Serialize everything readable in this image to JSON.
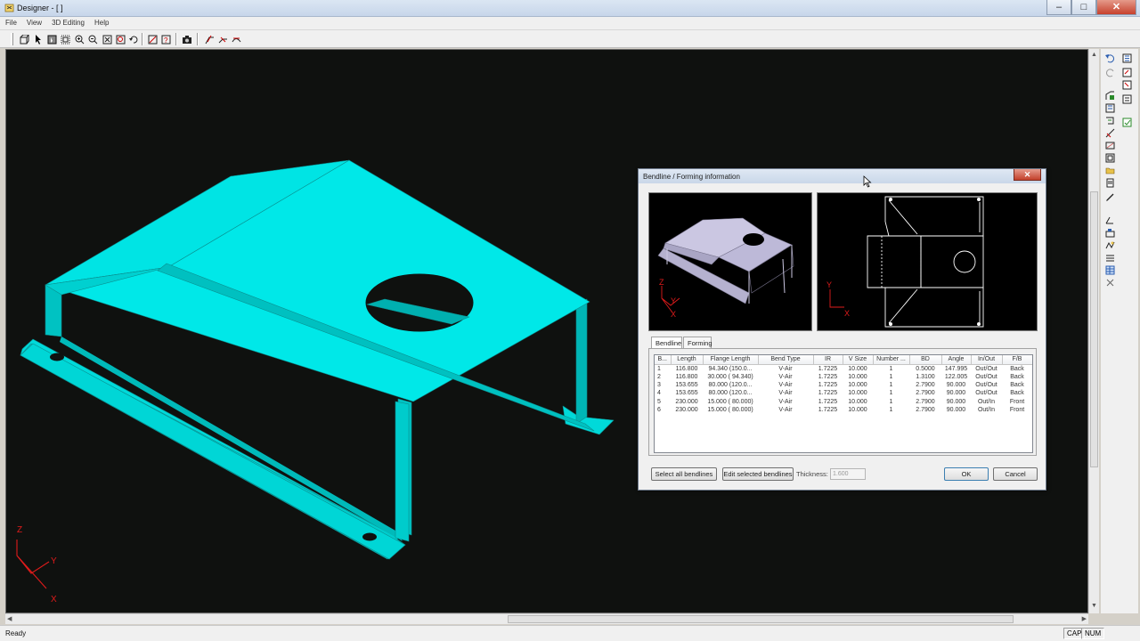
{
  "window": {
    "title": "Designer - [ ]",
    "min_glyph": "–",
    "max_glyph": "□",
    "close_glyph": "✕"
  },
  "menu": [
    "File",
    "View",
    "3D Editing",
    "Help"
  ],
  "toolbar_icons": [
    "box-view-icon",
    "pointer-icon",
    "select-icon",
    "grid-icon",
    "zoom-in-icon",
    "zoom-out-icon",
    "zoom-fit-icon",
    "zoom-window-icon",
    "rotate-icon",
    "measure-icon",
    "query-icon",
    "camera-icon",
    "bend-icon",
    "unfold-icon",
    "form-icon"
  ],
  "colors": {
    "part": "#00e6e6",
    "background": "#0f110f",
    "preview_part": "#b7b3d2",
    "axis": "#e01b1b"
  },
  "axes_labels": {
    "z": "Z",
    "y": "Y",
    "x": "X"
  },
  "dialog": {
    "title": "Bendline / Forming information",
    "close_glyph": "✕",
    "tabs": [
      "Bendline",
      "Forming"
    ],
    "columns": [
      "B...",
      "Length",
      "Flange Length",
      "Bend Type",
      "IR",
      "V Size",
      "Number ...",
      "BD",
      "Angle",
      "In/Out",
      "F/B"
    ],
    "rows": [
      [
        "1",
        "116.800",
        "94.340 (150.0...",
        "V-Air",
        "1.7225",
        "10.000",
        "1",
        "0.5000",
        "147.995",
        "Out/Out",
        "Back"
      ],
      [
        "2",
        "116.800",
        "30.000 ( 94.340)",
        "V-Air",
        "1.7225",
        "10.000",
        "1",
        "1.3100",
        "122.005",
        "Out/Out",
        "Back"
      ],
      [
        "3",
        "153.655",
        "80.000 (120.0...",
        "V-Air",
        "1.7225",
        "10.000",
        "1",
        "2.7900",
        "90.000",
        "Out/Out",
        "Back"
      ],
      [
        "4",
        "153.655",
        "80.000 (120.0...",
        "V-Air",
        "1.7225",
        "10.000",
        "1",
        "2.7900",
        "90.000",
        "Out/Out",
        "Back"
      ],
      [
        "5",
        "230.000",
        "15.000 ( 80.000)",
        "V-Air",
        "1.7225",
        "10.000",
        "1",
        "2.7900",
        "90.000",
        "Out/In",
        "Front"
      ],
      [
        "6",
        "230.000",
        "15.000 ( 80.000)",
        "V-Air",
        "1.7225",
        "10.000",
        "1",
        "2.7900",
        "90.000",
        "Out/In",
        "Front"
      ]
    ],
    "select_all_label": "Select all bendlines",
    "edit_selected_label": "Edit selected bendlines",
    "thickness_label": "Thickness:",
    "thickness_value": "1.600",
    "ok_label": "OK",
    "cancel_label": "Cancel"
  },
  "status": {
    "text": "Ready",
    "cap": "CAP",
    "num": "NUM"
  }
}
